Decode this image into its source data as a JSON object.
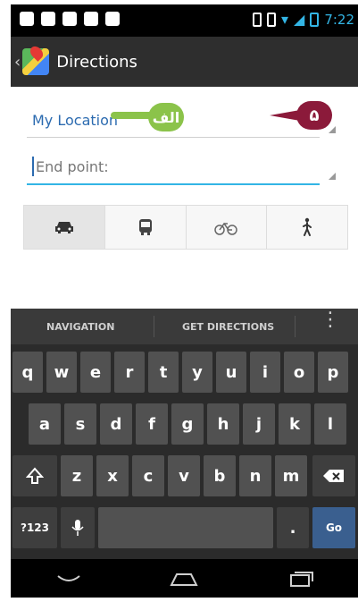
{
  "status": {
    "time": "7:22"
  },
  "actionbar": {
    "back_icon": "back-icon",
    "app_icon": "maps-icon",
    "title": "Directions"
  },
  "form": {
    "start": {
      "value": "My Location"
    },
    "end": {
      "placeholder": "End point:"
    }
  },
  "annotations": {
    "green_label": "الف",
    "red_label": "۵"
  },
  "modes": [
    {
      "name": "car",
      "icon": "car-icon"
    },
    {
      "name": "transit",
      "icon": "bus-icon"
    },
    {
      "name": "bike",
      "icon": "bike-icon"
    },
    {
      "name": "walk",
      "icon": "walk-icon"
    }
  ],
  "keyboard": {
    "suggestions": [
      "NAVIGATION",
      "GET DIRECTIONS"
    ],
    "row1": [
      "q",
      "w",
      "e",
      "r",
      "t",
      "y",
      "u",
      "i",
      "o",
      "p"
    ],
    "row2": [
      "a",
      "s",
      "d",
      "f",
      "g",
      "h",
      "j",
      "k",
      "l"
    ],
    "row3": [
      "z",
      "x",
      "c",
      "v",
      "b",
      "n",
      "m"
    ],
    "bottom": {
      "symbols": "?123",
      "period": ".",
      "go": "Go"
    }
  },
  "colors": {
    "accent_blue": "#33b5e5",
    "green_badge": "#8bc34a",
    "red_badge": "#8b1a3a"
  }
}
